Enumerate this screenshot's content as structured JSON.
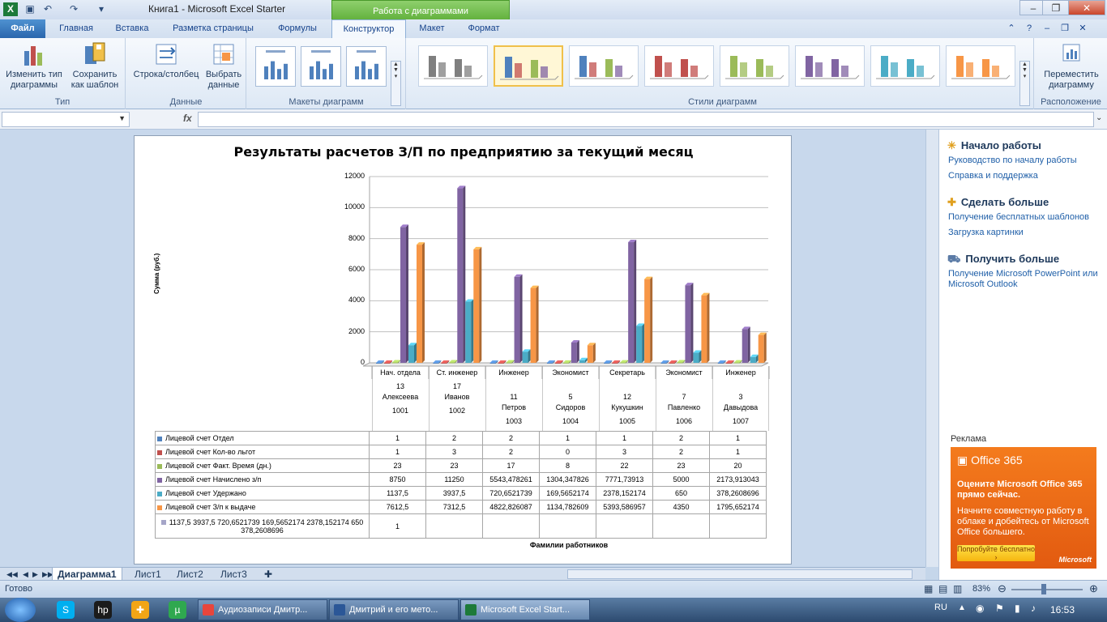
{
  "window": {
    "title": "Книга1  -  Microsoft Excel Starter",
    "context_tab": "Работа с диаграммами"
  },
  "tabs": [
    "Файл",
    "Главная",
    "Вставка",
    "Разметка страницы",
    "Формулы",
    "Конструктор",
    "Макет",
    "Формат"
  ],
  "ribbon": {
    "groups": {
      "type": "Тип",
      "data": "Данные",
      "layouts": "Макеты диаграмм",
      "styles": "Стили диаграмм",
      "location": "Расположение"
    },
    "buttons": {
      "change_type": [
        "Изменить тип",
        "диаграммы"
      ],
      "save_template": [
        "Сохранить",
        "как шаблон"
      ],
      "switch_row_col": [
        "Строка/столбец",
        ""
      ],
      "select_data": [
        "Выбрать",
        "данные"
      ],
      "move_chart": [
        "Переместить",
        "диаграмму"
      ]
    },
    "style_colors": [
      "#7f7f7f",
      "#4f81bd",
      "#4f81bd",
      "#c0504d",
      "#9bbb59",
      "#8064a2",
      "#4bacc6",
      "#f79646"
    ]
  },
  "formula_bar": {
    "fx": "fx",
    "name_box": "",
    "formula": ""
  },
  "chart_data": {
    "type": "bar",
    "title": "Результаты расчетов З/П по предприятию за текущий месяц",
    "ylabel": "Сумма (руб.)",
    "xlabel": "Фамилии работников",
    "ylim": [
      0,
      12000
    ],
    "yticks": [
      "12000",
      "10000",
      "8000",
      "6000",
      "4000",
      "2000",
      "0"
    ],
    "categories": [
      {
        "role": "Нач. отдела",
        "id": "13",
        "name": "Алексеева",
        "num": "1001"
      },
      {
        "role": "Ст. инженер",
        "id": "17",
        "name": "Иванов",
        "num": "1002"
      },
      {
        "role": "Инженер",
        "id": "11",
        "name": "Петров",
        "num": "1003"
      },
      {
        "role": "Экономист",
        "id": "5",
        "name": "Сидоров",
        "num": "1004"
      },
      {
        "role": "Секретарь",
        "id": "12",
        "name": "Кукушкин",
        "num": "1005"
      },
      {
        "role": "Экономист",
        "id": "7",
        "name": "Павленко",
        "num": "1006"
      },
      {
        "role": "Инженер",
        "id": "3",
        "name": "Давыдова",
        "num": "1007"
      }
    ],
    "series": [
      {
        "name": "Лицевой счет Отдел",
        "color": "#4f81bd",
        "values": [
          1,
          2,
          2,
          1,
          1,
          2,
          1
        ],
        "labels": [
          "1",
          "2",
          "2",
          "1",
          "1",
          "2",
          "1"
        ]
      },
      {
        "name": "Лицевой счет Кол-во льгот",
        "color": "#c0504d",
        "values": [
          1,
          3,
          2,
          0,
          3,
          2,
          1
        ],
        "labels": [
          "1",
          "3",
          "2",
          "0",
          "3",
          "2",
          "1"
        ]
      },
      {
        "name": "Лицевой счет Факт. Время (дн.)",
        "color": "#9bbb59",
        "values": [
          23,
          23,
          17,
          8,
          22,
          23,
          20
        ],
        "labels": [
          "23",
          "23",
          "17",
          "8",
          "22",
          "23",
          "20"
        ]
      },
      {
        "name": "Лицевой счет Начислено з/п",
        "color": "#8064a2",
        "values": [
          8750,
          11250,
          5543.478261,
          1304.347826,
          7771.73913,
          5000,
          2173.913043
        ],
        "labels": [
          "8750",
          "11250",
          "5543,478261",
          "1304,347826",
          "7771,73913",
          "5000",
          "2173,913043"
        ]
      },
      {
        "name": "Лицевой счет Удержано",
        "color": "#4bacc6",
        "values": [
          1137.5,
          3937.5,
          720.6521739,
          169.5652174,
          2378.152174,
          650,
          378.2608696
        ],
        "labels": [
          "1137,5",
          "3937,5",
          "720,6521739",
          "169,5652174",
          "2378,152174",
          "650",
          "378,2608696"
        ]
      },
      {
        "name": "Лицевой счет З/п к выдаче",
        "color": "#f79646",
        "values": [
          7612.5,
          7312.5,
          4822.826087,
          1134.782609,
          5393.586957,
          4350,
          1795.652174
        ],
        "labels": [
          "7612,5",
          "7312,5",
          "4822,826087",
          "1134,782609",
          "5393,586957",
          "4350",
          "1795,652174"
        ]
      },
      {
        "name": "1137,5 3937,5 720,6521739 169,5652174 2378,152174 650 378,2608696",
        "color": "#a5a5c8",
        "values": [
          1,
          null,
          null,
          null,
          null,
          null,
          null
        ],
        "labels": [
          "1",
          "",
          "",
          "",
          "",
          "",
          ""
        ]
      }
    ]
  },
  "task_pane": {
    "sections": [
      {
        "title": "Начало работы",
        "links": [
          "Руководство по началу работы",
          "Справка и поддержка"
        ]
      },
      {
        "title": "Сделать больше",
        "links": [
          "Получение бесплатных шаблонов",
          "Загрузка картинки"
        ]
      },
      {
        "title": "Получить больше",
        "links": [
          "Получение Microsoft PowerPoint или Microsoft Outlook"
        ]
      }
    ],
    "ad": {
      "label": "Реклама",
      "logo": "Office 365",
      "heading": "Оцените Microsoft Office 365 прямо сейчас.",
      "body": "Начните совместную работу в облаке и добейтесь от Microsoft Office большего.",
      "button": "Попробуйте бесплатно ›",
      "brand": "Microsoft"
    }
  },
  "sheets": [
    "Диаграмма1",
    "Лист1",
    "Лист2",
    "Лист3"
  ],
  "status": {
    "ready": "Готово",
    "zoom": "83%"
  },
  "taskbar": {
    "tasks": [
      "Аудиозаписи Дмитр...",
      "Дмитрий и его мето...",
      "Microsoft Excel Start..."
    ],
    "lang": "RU",
    "clock": "16:53"
  }
}
